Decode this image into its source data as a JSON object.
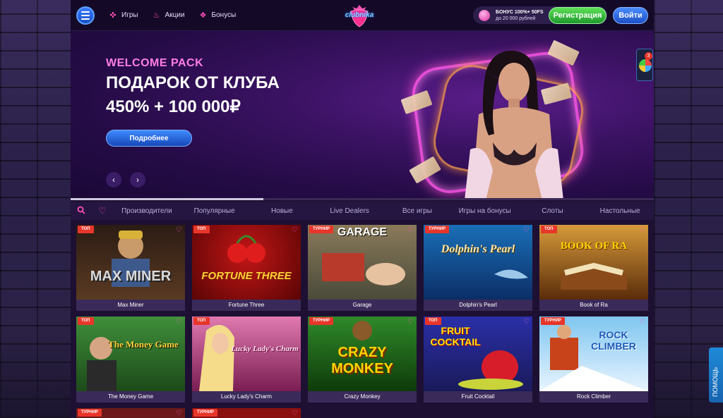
{
  "header": {
    "nav": [
      {
        "label": "Игры",
        "icon": "gamepad-icon"
      },
      {
        "label": "Акции",
        "icon": "fire-icon"
      },
      {
        "label": "Бонусы",
        "icon": "gift-icon"
      }
    ],
    "logo_text": "clubnika",
    "bonus_line1": "БОНУС 100%+ 50FS",
    "bonus_line2": "до 20 000 рублей",
    "register_label": "Регистрация",
    "login_label": "Войти"
  },
  "hero": {
    "kicker": "WELCOME PACK",
    "title": "ПОДАРОК ОТ КЛУБА",
    "amount": "450% + 100 000₽",
    "button_label": "Подробнее",
    "progress": 0.33
  },
  "tabs": [
    "Производители",
    "Популярные",
    "Новые",
    "Live Dealers",
    "Все игры",
    "Игры на бонусы",
    "Слоты",
    "Настольные"
  ],
  "games": [
    {
      "name": "Max Miner",
      "badge": "ТОП",
      "art": "MAX MINER"
    },
    {
      "name": "Fortune Three",
      "badge": "ТОП",
      "art": "FORTUNE THREE"
    },
    {
      "name": "Garage",
      "badge": "ТУРНИР",
      "art": "GARAGE"
    },
    {
      "name": "Dolphin's Pearl",
      "badge": "ТУРНИР",
      "art": "Dolphin's Pearl"
    },
    {
      "name": "Book of Ra",
      "badge": "ТОП",
      "art": "BOOK OF RA"
    },
    {
      "name": "The Money Game",
      "badge": "ТОП",
      "art": "The Money Game"
    },
    {
      "name": "Lucky Lady's Charm",
      "badge": "ТОП",
      "art": "Lucky Lady's Charm"
    },
    {
      "name": "Crazy Monkey",
      "badge": "ТУРНИР",
      "art": "CRAZY MONKEY"
    },
    {
      "name": "Fruit Cocktail",
      "badge": "ТОП",
      "art": "FRUIT COCKTAIL"
    },
    {
      "name": "Rock Climber",
      "badge": "ТУРНИР",
      "art": "ROCK CLIMBER"
    }
  ],
  "partial_badges": [
    "ТУРНИР",
    "ТУРНИР"
  ],
  "side": {
    "notification_count": "3",
    "help_label": "ПОМОЩЬ"
  }
}
